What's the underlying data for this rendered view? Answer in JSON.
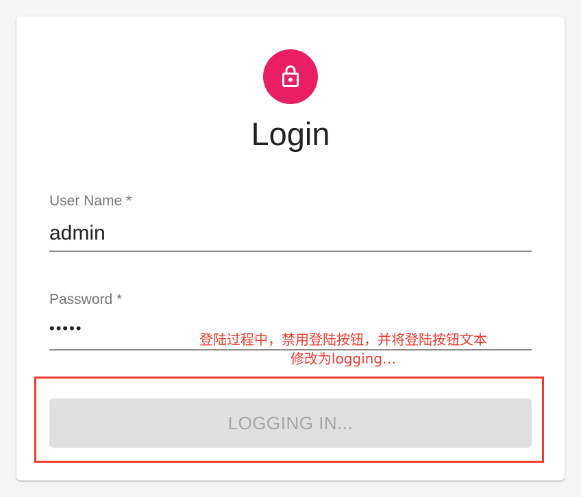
{
  "header": {
    "title": "Login",
    "avatar_icon": "lock-icon",
    "avatar_color": "#e91e63"
  },
  "form": {
    "username": {
      "label": "User Name",
      "required_mark": "*",
      "value": "admin"
    },
    "password": {
      "label": "Password",
      "required_mark": "*",
      "value": "•••••"
    },
    "submit": {
      "label": "LOGGING IN...",
      "disabled": true
    }
  },
  "annotation": {
    "line1": "登陆过程中，禁用登陆按钮，并将登陆按钮文本",
    "line2": "修改为logging…",
    "color": "#ef3a2e"
  }
}
